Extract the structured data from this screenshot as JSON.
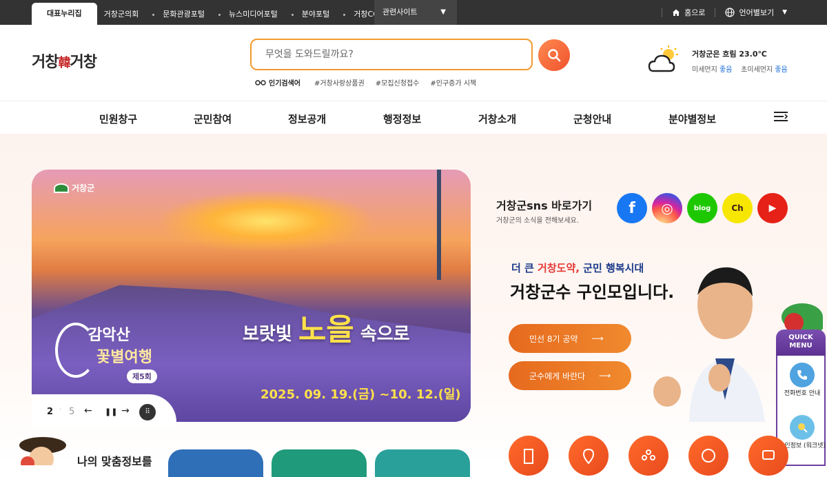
{
  "topbar": {
    "active_tab": "대표누리집",
    "links": [
      "거창군의회",
      "문화관광포털",
      "뉴스미디어포털",
      "분야포털",
      "거창CC"
    ],
    "related_sites": "관련사이트",
    "home": "홈으로",
    "language": "언어별보기"
  },
  "header": {
    "search_placeholder": "무엇을 도와드릴까요?",
    "popular_label": "인기검색어",
    "popular_keywords": [
      "#거창사랑상품권",
      "#모집신청접수",
      "#인구증가 시책"
    ],
    "weather": {
      "line1": "거창군은 흐림 23.0℃",
      "fine_dust_label": "미세먼지",
      "fine_dust_value": "좋음",
      "ultra_fine_dust_label": "초미세먼지",
      "ultra_fine_dust_value": "좋음"
    }
  },
  "gnb": [
    "민원창구",
    "군민참여",
    "정보공개",
    "행정정보",
    "거창소개",
    "군청안내",
    "분야별정보"
  ],
  "banner": {
    "logo_text": "거창군",
    "headline_a": "보랏빛 ",
    "headline_b": "노을",
    "headline_c": " 속으로",
    "fest_line1": "감악산",
    "fest_line2": "꽃별여행",
    "fest_edition": "제5회",
    "date": "2025. 09. 19.(금) ~10. 12.(일)",
    "current": "2",
    "total": "5"
  },
  "sns": {
    "title": "거창군sns 바로가기",
    "subtitle": "거창군의 소식을 전해보세요.",
    "items": [
      {
        "name": "facebook",
        "glyph": "f",
        "color": "#1877f2"
      },
      {
        "name": "instagram",
        "glyph": "◎",
        "color": "#d6249f"
      },
      {
        "name": "blog",
        "glyph": "blog",
        "color": "#1ec800"
      },
      {
        "name": "kakao-channel",
        "glyph": "Ch",
        "color": "#f7e600"
      },
      {
        "name": "youtube",
        "glyph": "▶",
        "color": "#e62117"
      }
    ]
  },
  "governor": {
    "slogan_a": "더 큰 ",
    "slogan_b": "거창도약,",
    "slogan_c": " 군민 행복시대",
    "title": "거창군수 구인모입니다.",
    "btn1": "민선 8기 공약",
    "btn2": "군수에게 바란다"
  },
  "quick_menu": {
    "title": "QUICK MENU",
    "item1": "전화번호 안내",
    "item2": "구인정보 (워크넷)"
  },
  "my_info": {
    "title": "나의 맞춤정보를"
  }
}
